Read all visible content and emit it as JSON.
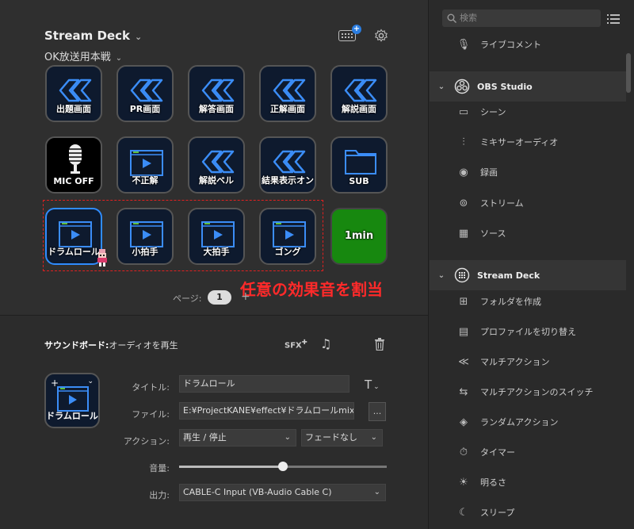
{
  "header": {
    "title": "Stream Deck",
    "profile": "OK放送用本戦"
  },
  "keys": [
    {
      "label": "出題画面",
      "icon": "chevrons-icon",
      "style": "navy"
    },
    {
      "label": "PR画面",
      "icon": "chevrons-icon",
      "style": "navy"
    },
    {
      "label": "解答画面",
      "icon": "chevrons-icon",
      "style": "navy"
    },
    {
      "label": "正解画面",
      "icon": "chevrons-icon",
      "style": "navy"
    },
    {
      "label": "解説画面",
      "icon": "chevrons-icon",
      "style": "navy"
    },
    {
      "label": "MIC OFF",
      "icon": "microphone-icon",
      "style": "black"
    },
    {
      "label": "不正解",
      "icon": "player-icon",
      "style": "navy"
    },
    {
      "label": "解説ベル",
      "icon": "chevrons-icon",
      "style": "navy"
    },
    {
      "label": "結果表示オン",
      "icon": "chevrons-icon",
      "style": "navy"
    },
    {
      "label": "SUB",
      "icon": "folder-icon",
      "style": "navy"
    },
    {
      "label": "ドラムロール",
      "icon": "player-icon",
      "style": "navy",
      "selected": true
    },
    {
      "label": "小拍手",
      "icon": "player-icon",
      "style": "navy"
    },
    {
      "label": "大拍手",
      "icon": "player-icon",
      "style": "navy"
    },
    {
      "label": "ゴング",
      "icon": "player-icon",
      "style": "navy"
    },
    {
      "label": "1min",
      "icon": "none",
      "style": "green"
    }
  ],
  "annotation": "任意の効果音を割当",
  "pager": {
    "label": "ページ:",
    "current": "1",
    "add": "+"
  },
  "properties": {
    "action_name": "サウンドボード:",
    "action_desc": "オーディオを再生",
    "sfx_label": "SFX",
    "key_label": "ドラムロール",
    "title_label": "タイトル:",
    "title_value": "ドラムロール",
    "file_label": "ファイル:",
    "file_value": "E:¥ProjectKANE¥effect¥ドラムロールmix.wav",
    "browse": "...",
    "action_label": "アクション:",
    "action_value": "再生 / 停止",
    "fade_value": "フェードなし",
    "volume_label": "音量:",
    "volume": 0.5,
    "output_label": "出力:",
    "output_value": "CABLE-C Input (VB-Audio Cable C)"
  },
  "sidebar": {
    "search_placeholder": "検索",
    "items": [
      {
        "label": "ライブコメント",
        "icon": "microphone-icon"
      },
      {
        "label": "OBS Studio",
        "icon": "obs-icon",
        "header": true
      },
      {
        "label": "シーン",
        "icon": "scene-icon"
      },
      {
        "label": "ミキサーオーディオ",
        "icon": "mixer-icon"
      },
      {
        "label": "録画",
        "icon": "record-icon"
      },
      {
        "label": "ストリーム",
        "icon": "stream-icon"
      },
      {
        "label": "ソース",
        "icon": "source-icon"
      },
      {
        "label": "Stream Deck",
        "icon": "streamdeck-icon",
        "header": true
      },
      {
        "label": "フォルダを作成",
        "icon": "folder-add-icon"
      },
      {
        "label": "プロファイルを切り替え",
        "icon": "grid-icon"
      },
      {
        "label": "マルチアクション",
        "icon": "multi-action-icon"
      },
      {
        "label": "マルチアクションのスイッチ",
        "icon": "multi-action-switch-icon"
      },
      {
        "label": "ランダムアクション",
        "icon": "random-action-icon"
      },
      {
        "label": "タイマー",
        "icon": "timer-icon"
      },
      {
        "label": "明るさ",
        "icon": "brightness-icon"
      },
      {
        "label": "スリープ",
        "icon": "sleep-icon"
      }
    ]
  }
}
